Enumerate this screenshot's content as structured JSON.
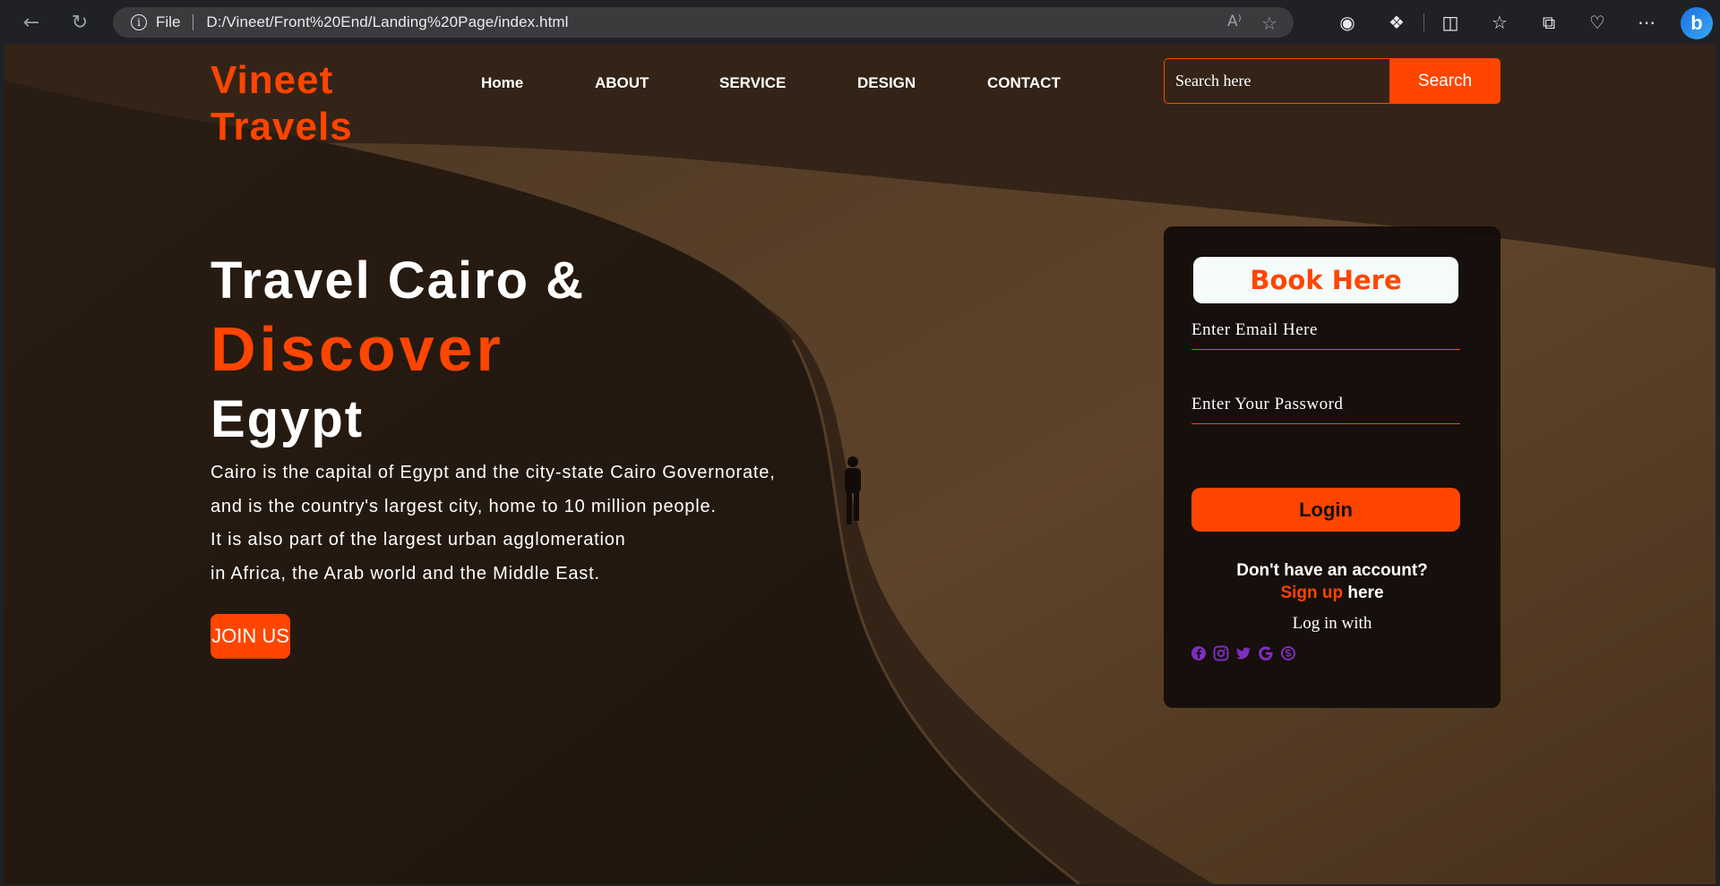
{
  "browser": {
    "protocol_label": "File",
    "url": "D:/Vineet/Front%20End/Landing%20Page/index.html"
  },
  "site": {
    "logo_line1": "Vineet",
    "logo_line2": "Travels",
    "nav": [
      "Home",
      "ABOUT",
      "SERVICE",
      "DESIGN",
      "CONTACT"
    ],
    "search": {
      "placeholder": "Search here",
      "button": "Search"
    }
  },
  "hero": {
    "line1": "Travel Cairo &",
    "line2": "Discover",
    "line3": "Egypt",
    "description": [
      "Cairo is the capital of Egypt and the city-state Cairo Governorate,",
      "and is the country's largest city, home to 10 million people.",
      "It is also part of the largest urban agglomeration",
      "in Africa, the Arab world and the Middle East."
    ],
    "join_button": "JOIN US"
  },
  "login_card": {
    "title": "Book Here",
    "email_placeholder": "Enter Email Here",
    "password_placeholder": "Enter Your Password",
    "login_button": "Login",
    "no_account": "Don't have an account?",
    "signup_link": "Sign up",
    "signup_suffix": " here",
    "login_with": "Log in with",
    "social_icons": [
      "facebook-icon",
      "instagram-icon",
      "twitter-icon",
      "google-icon",
      "skype-icon"
    ]
  },
  "colors": {
    "accent": "#ff4500",
    "social_icon": "#7b2fbe",
    "card_bg": "#120c0a"
  }
}
